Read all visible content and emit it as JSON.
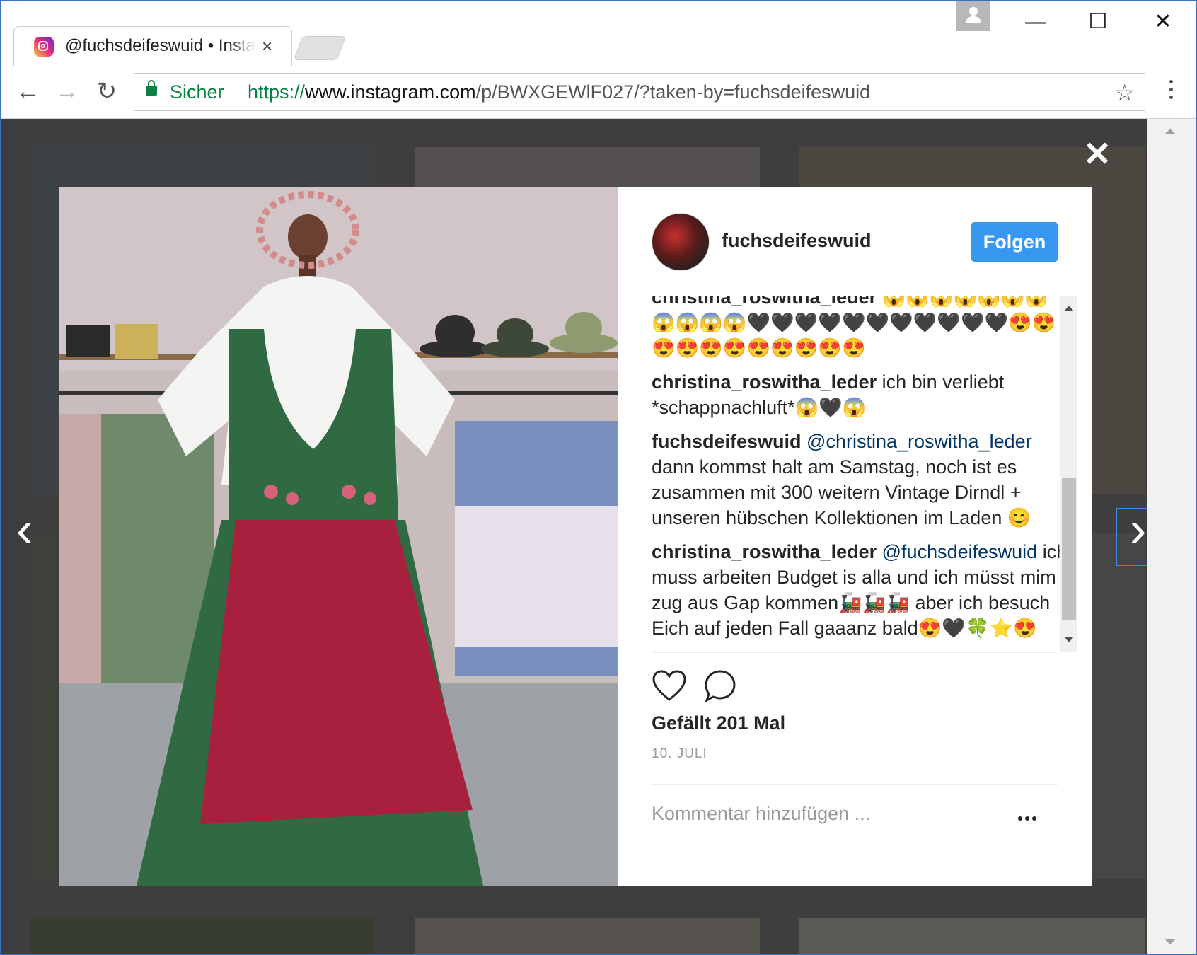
{
  "browser": {
    "tab_title": "@fuchsdeifeswuid • Instagram",
    "tab_close": "×",
    "secure_label": "Sicher",
    "url_scheme": "https://",
    "url_host": "www.instagram.com",
    "url_path": "/p/BWXGEWlF027/?taken-by=fuchsdeifeswuid",
    "back": "←",
    "forward": "→",
    "reload": "↻",
    "star": "☆",
    "minimize": "—",
    "maximize": "☐",
    "close": "✕"
  },
  "lightbox": {
    "close": "✕",
    "prev": "‹",
    "next": "›"
  },
  "post": {
    "username": "fuchsdeifeswuid",
    "follow_label": "Folgen",
    "likes": "Gefällt 201 Mal",
    "date": "10. JULI",
    "add_comment_placeholder": "Kommentar hinzufügen ...",
    "comments": [
      {
        "user": "christina_roswitha_leder",
        "mention": "",
        "text": "😱😱😱😱😱😱😱😱😱😱😱🖤🖤🖤🖤🖤🖤🖤🖤🖤🖤🖤😍😍😍😍😍😍😍😍😍😍😍"
      },
      {
        "user": "christina_roswitha_leder",
        "mention": "",
        "text": "ich bin verliebt *schappnachluft*😱🖤😱"
      },
      {
        "user": "fuchsdeifeswuid",
        "mention": "@christina_roswitha_leder",
        "text": "dann kommst halt am Samstag, noch ist es zusammen mit 300 weitern Vintage Dirndl + unseren hübschen Kollektionen im Laden 😊"
      },
      {
        "user": "christina_roswitha_leder",
        "mention": "@fuchsdeifeswuid",
        "text": "ich muss arbeiten Budget is alla und ich müsst mim zug aus Gap kommen🚂🚂🚂 aber ich besuch Eich auf jeden Fall gaaanz bald😍🖤🍀⭐😍"
      }
    ]
  },
  "colors": {
    "follow_button": "#3897f0",
    "secure_green": "#0b8043",
    "mention_blue": "#003569"
  },
  "icons": [
    "instagram-icon",
    "lock-icon",
    "star-icon",
    "heart-icon",
    "comment-icon",
    "more-icon",
    "close-icon",
    "chevron-left-icon",
    "chevron-right-icon"
  ]
}
